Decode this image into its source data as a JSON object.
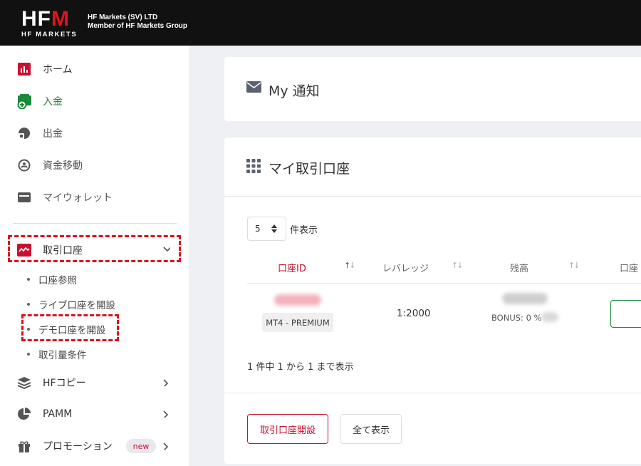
{
  "header": {
    "logo_main_a": "HF",
    "logo_main_b": "M",
    "logo_sub": "HF MARKETS",
    "company_line1": "HF Markets (SV) LTD",
    "company_line2": "Member of HF Markets Group"
  },
  "sidebar": {
    "items": [
      {
        "label": "ホーム",
        "icon": "bar-chart-icon"
      },
      {
        "label": "入金",
        "icon": "deposit-wallet-icon"
      },
      {
        "label": "出金",
        "icon": "withdraw-icon"
      },
      {
        "label": "資金移動",
        "icon": "transfer-icon"
      },
      {
        "label": "マイウォレット",
        "icon": "wallet-icon"
      }
    ],
    "trading": {
      "label": "取引口座",
      "icon": "trading-account-icon"
    },
    "sub_items": [
      "口座参照",
      "ライブ口座を開設",
      "デモ口座を開設",
      "取引量条件"
    ],
    "bottom_items": [
      {
        "label": "HFコピー",
        "icon": "layers-icon"
      },
      {
        "label": "PAMM",
        "icon": "pie-chart-icon"
      },
      {
        "label": "プロモーション",
        "icon": "gift-icon",
        "badge": "new"
      }
    ]
  },
  "notifications": {
    "title": "My 通知"
  },
  "accounts": {
    "title": "マイ取引口座",
    "page_size": "5",
    "page_size_label": "件表示",
    "columns": [
      "口座ID",
      "レバレッジ",
      "残高",
      "口座"
    ],
    "row": {
      "type": "MT4 - PREMIUM",
      "leverage": "1:2000",
      "bonus": "BONUS: 0 %"
    },
    "summary": "1 件中 1 から 1 まで表示",
    "open_button": "取引口座開設",
    "all_button": "全て表示"
  },
  "colors": {
    "brand_red": "#c8102e",
    "green": "#1a8a3a",
    "header_bg": "#111111"
  }
}
